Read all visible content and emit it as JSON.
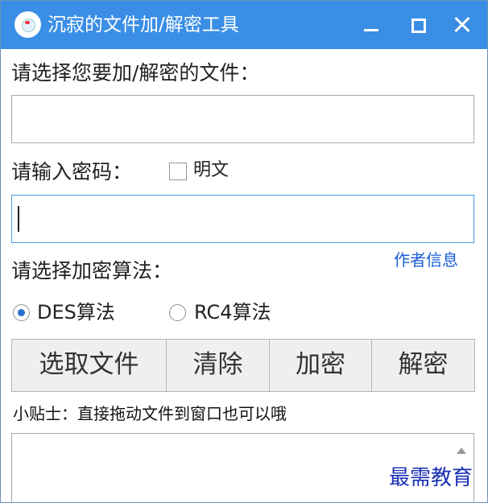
{
  "window": {
    "title": "沉寂的文件加/解密工具"
  },
  "file_section": {
    "label": "请选择您要加/解密的文件：",
    "path_value": ""
  },
  "password_section": {
    "label": "请输入密码：",
    "plaintext_label": "明文",
    "plaintext_checked": false,
    "password_value": ""
  },
  "author_link": "作者信息",
  "algorithm_section": {
    "label": "请选择加密算法：",
    "options": [
      {
        "label": "DES算法",
        "selected": true
      },
      {
        "label": "RC4算法",
        "selected": false
      }
    ]
  },
  "buttons": {
    "select_file": "选取文件",
    "clear": "清除",
    "encrypt": "加密",
    "decrypt": "解密"
  },
  "tip": "小贴士：直接拖动文件到窗口也可以哦",
  "log_text": "",
  "watermark": "最需教育",
  "colors": {
    "titlebar": "#3a8ee6",
    "link": "#1a5fd6",
    "radio_selected": "#2a6fd0"
  }
}
